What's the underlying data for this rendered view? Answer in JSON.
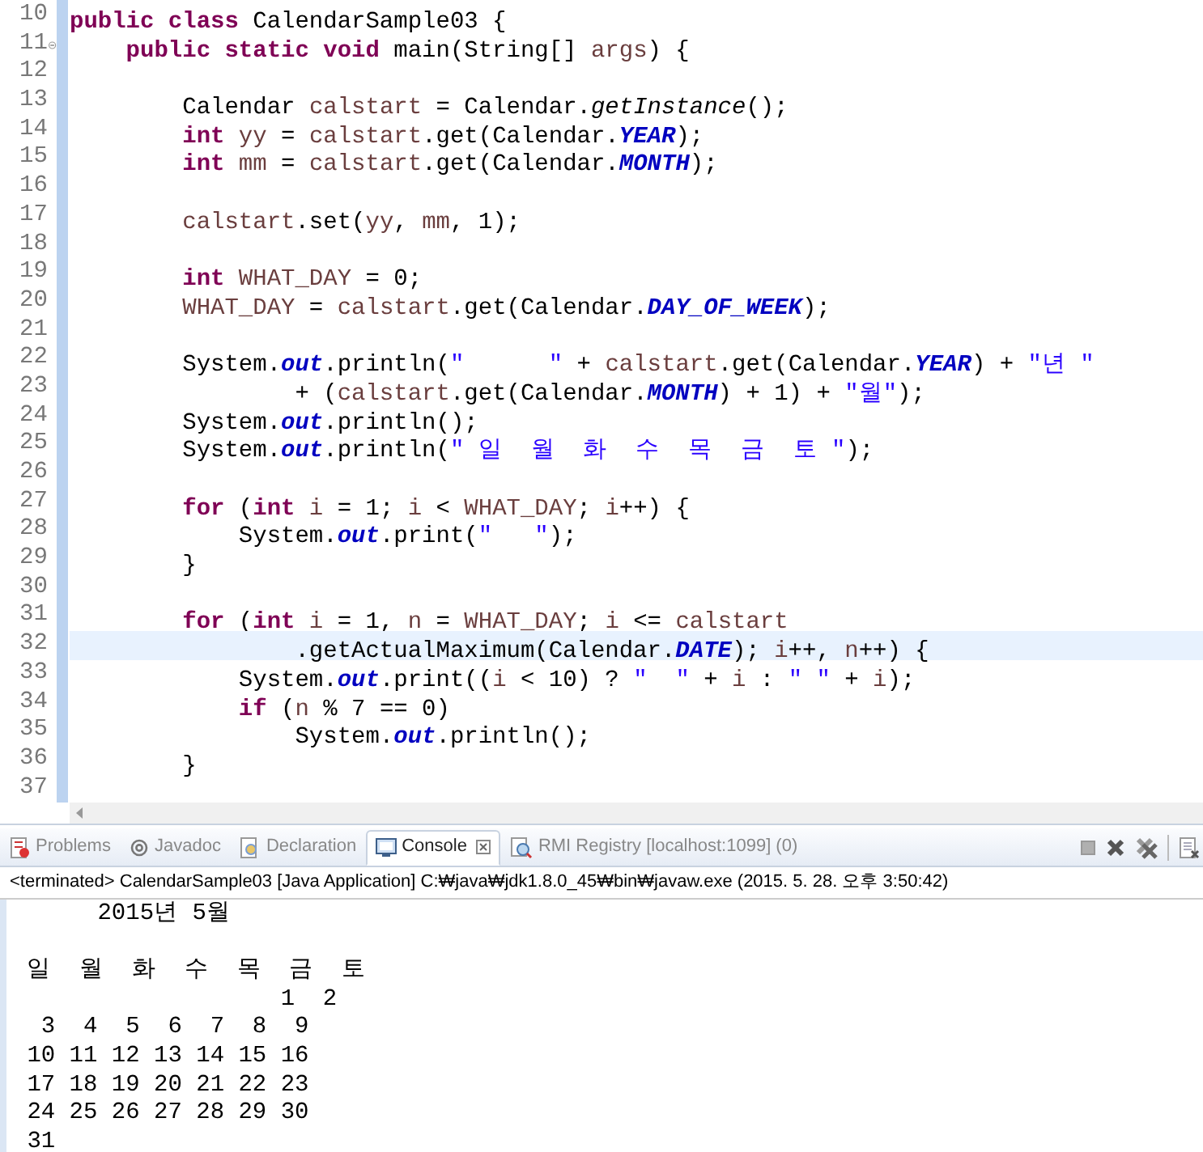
{
  "editor": {
    "lines": [
      {
        "number": "10",
        "foldable": false,
        "current": false,
        "tokens": [
          {
            "kind": "kw",
            "text": "public class"
          },
          {
            "kind": "p",
            "text": " CalendarSample03 {"
          }
        ]
      },
      {
        "number": "11",
        "foldable": true,
        "current": false,
        "tokens": [
          {
            "kind": "kw",
            "text": "    public static void"
          },
          {
            "kind": "p",
            "text": " main(String[] "
          },
          {
            "kind": "var",
            "text": "args"
          },
          {
            "kind": "p",
            "text": ") {"
          }
        ]
      },
      {
        "number": "12",
        "foldable": false,
        "current": false
      },
      {
        "number": "13",
        "foldable": false,
        "current": false,
        "tokens": [
          {
            "kind": "p",
            "text": "        Calendar "
          },
          {
            "kind": "var",
            "text": "calstart"
          },
          {
            "kind": "p",
            "text": " = Calendar."
          },
          {
            "kind": "m",
            "text": "getInstance"
          },
          {
            "kind": "p",
            "text": "();"
          }
        ]
      },
      {
        "number": "14",
        "foldable": false,
        "current": false,
        "tokens": [
          {
            "kind": "kw",
            "text": "        int"
          },
          {
            "kind": "var",
            "text": " yy"
          },
          {
            "kind": "p",
            "text": " = "
          },
          {
            "kind": "var",
            "text": "calstart"
          },
          {
            "kind": "p",
            "text": ".get(Calendar."
          },
          {
            "kind": "c",
            "text": "YEAR"
          },
          {
            "kind": "p",
            "text": ");"
          }
        ]
      },
      {
        "number": "15",
        "foldable": false,
        "current": false,
        "tokens": [
          {
            "kind": "kw",
            "text": "        int"
          },
          {
            "kind": "var",
            "text": " mm"
          },
          {
            "kind": "p",
            "text": " = "
          },
          {
            "kind": "var",
            "text": "calstart"
          },
          {
            "kind": "p",
            "text": ".get(Calendar."
          },
          {
            "kind": "c",
            "text": "MONTH"
          },
          {
            "kind": "p",
            "text": ");"
          }
        ]
      },
      {
        "number": "16",
        "foldable": false,
        "current": false
      },
      {
        "number": "17",
        "foldable": false,
        "current": false,
        "tokens": [
          {
            "kind": "var",
            "text": "        calstart"
          },
          {
            "kind": "p",
            "text": ".set("
          },
          {
            "kind": "var",
            "text": "yy"
          },
          {
            "kind": "p",
            "text": ", "
          },
          {
            "kind": "var",
            "text": "mm"
          },
          {
            "kind": "p",
            "text": ", 1);"
          }
        ]
      },
      {
        "number": "18",
        "foldable": false,
        "current": false
      },
      {
        "number": "19",
        "foldable": false,
        "current": false,
        "tokens": [
          {
            "kind": "kw",
            "text": "        int"
          },
          {
            "kind": "var",
            "text": " WHAT_DAY"
          },
          {
            "kind": "p",
            "text": " = 0;"
          }
        ]
      },
      {
        "number": "20",
        "foldable": false,
        "current": false,
        "tokens": [
          {
            "kind": "var",
            "text": "        WHAT_DAY"
          },
          {
            "kind": "p",
            "text": " = "
          },
          {
            "kind": "var",
            "text": "calstart"
          },
          {
            "kind": "p",
            "text": ".get(Calendar."
          },
          {
            "kind": "c",
            "text": "DAY_OF_WEEK"
          },
          {
            "kind": "p",
            "text": ");"
          }
        ]
      },
      {
        "number": "21",
        "foldable": false,
        "current": false
      },
      {
        "number": "22",
        "foldable": false,
        "current": false,
        "tokens": [
          {
            "kind": "p",
            "text": "        System."
          },
          {
            "kind": "c",
            "text": "out"
          },
          {
            "kind": "p",
            "text": ".println("
          },
          {
            "kind": "s",
            "text": "\"      \""
          },
          {
            "kind": "p",
            "text": " + "
          },
          {
            "kind": "var",
            "text": "calstart"
          },
          {
            "kind": "p",
            "text": ".get(Calendar."
          },
          {
            "kind": "c",
            "text": "YEAR"
          },
          {
            "kind": "p",
            "text": ") + "
          },
          {
            "kind": "s",
            "text": "\"년 \""
          }
        ]
      },
      {
        "number": "23",
        "foldable": false,
        "current": false,
        "tokens": [
          {
            "kind": "p",
            "text": "                + ("
          },
          {
            "kind": "var",
            "text": "calstart"
          },
          {
            "kind": "p",
            "text": ".get(Calendar."
          },
          {
            "kind": "c",
            "text": "MONTH"
          },
          {
            "kind": "p",
            "text": ") + 1) + "
          },
          {
            "kind": "s",
            "text": "\"월\""
          },
          {
            "kind": "p",
            "text": ");"
          }
        ]
      },
      {
        "number": "24",
        "foldable": false,
        "current": false,
        "tokens": [
          {
            "kind": "p",
            "text": "        System."
          },
          {
            "kind": "c",
            "text": "out"
          },
          {
            "kind": "p",
            "text": ".println();"
          }
        ]
      },
      {
        "number": "25",
        "foldable": false,
        "current": false,
        "tokens": [
          {
            "kind": "p",
            "text": "        System."
          },
          {
            "kind": "c",
            "text": "out"
          },
          {
            "kind": "p",
            "text": ".println("
          },
          {
            "kind": "s",
            "text": "\" 일  월  화  수  목  금  토 \""
          },
          {
            "kind": "p",
            "text": ");"
          }
        ]
      },
      {
        "number": "26",
        "foldable": false,
        "current": false
      },
      {
        "number": "27",
        "foldable": false,
        "current": false,
        "tokens": [
          {
            "kind": "kw",
            "text": "        for"
          },
          {
            "kind": "p",
            "text": " ("
          },
          {
            "kind": "kw",
            "text": "int"
          },
          {
            "kind": "var",
            "text": " i"
          },
          {
            "kind": "p",
            "text": " = 1; "
          },
          {
            "kind": "var",
            "text": "i"
          },
          {
            "kind": "p",
            "text": " < "
          },
          {
            "kind": "var",
            "text": "WHAT_DAY"
          },
          {
            "kind": "p",
            "text": "; "
          },
          {
            "kind": "var",
            "text": "i"
          },
          {
            "kind": "p",
            "text": "++) {"
          }
        ]
      },
      {
        "number": "28",
        "foldable": false,
        "current": false,
        "tokens": [
          {
            "kind": "p",
            "text": "            System."
          },
          {
            "kind": "c",
            "text": "out"
          },
          {
            "kind": "p",
            "text": ".print("
          },
          {
            "kind": "s",
            "text": "\"   \""
          },
          {
            "kind": "p",
            "text": ");"
          }
        ]
      },
      {
        "number": "29",
        "foldable": false,
        "current": false,
        "tokens": [
          {
            "kind": "p",
            "text": "        }"
          }
        ]
      },
      {
        "number": "30",
        "foldable": false,
        "current": false
      },
      {
        "number": "31",
        "foldable": false,
        "current": false,
        "tokens": [
          {
            "kind": "kw",
            "text": "        for"
          },
          {
            "kind": "p",
            "text": " ("
          },
          {
            "kind": "kw",
            "text": "int"
          },
          {
            "kind": "var",
            "text": " i"
          },
          {
            "kind": "p",
            "text": " = 1, "
          },
          {
            "kind": "var",
            "text": "n"
          },
          {
            "kind": "p",
            "text": " = "
          },
          {
            "kind": "var",
            "text": "WHAT_DAY"
          },
          {
            "kind": "p",
            "text": "; "
          },
          {
            "kind": "var",
            "text": "i"
          },
          {
            "kind": "p",
            "text": " <= "
          },
          {
            "kind": "var",
            "text": "calstart"
          }
        ]
      },
      {
        "number": "32",
        "foldable": false,
        "current": true,
        "tokens": [
          {
            "kind": "p",
            "text": "                .getActualMaximum(Calendar."
          },
          {
            "kind": "c",
            "text": "DATE"
          },
          {
            "kind": "p",
            "text": "); "
          },
          {
            "kind": "var",
            "text": "i"
          },
          {
            "kind": "p",
            "text": "++, "
          },
          {
            "kind": "var",
            "text": "n"
          },
          {
            "kind": "p",
            "text": "++) {"
          }
        ]
      },
      {
        "number": "33",
        "foldable": false,
        "current": false,
        "tokens": [
          {
            "kind": "p",
            "text": "            System."
          },
          {
            "kind": "c",
            "text": "out"
          },
          {
            "kind": "p",
            "text": ".print(("
          },
          {
            "kind": "var",
            "text": "i"
          },
          {
            "kind": "p",
            "text": " < 10) ? "
          },
          {
            "kind": "s",
            "text": "\"  \""
          },
          {
            "kind": "p",
            "text": " + "
          },
          {
            "kind": "var",
            "text": "i"
          },
          {
            "kind": "p",
            "text": " : "
          },
          {
            "kind": "s",
            "text": "\" \""
          },
          {
            "kind": "p",
            "text": " + "
          },
          {
            "kind": "var",
            "text": "i"
          },
          {
            "kind": "p",
            "text": ");"
          }
        ]
      },
      {
        "number": "34",
        "foldable": false,
        "current": false,
        "tokens": [
          {
            "kind": "kw",
            "text": "            if"
          },
          {
            "kind": "p",
            "text": " ("
          },
          {
            "kind": "var",
            "text": "n"
          },
          {
            "kind": "p",
            "text": " % 7 == 0)"
          }
        ]
      },
      {
        "number": "35",
        "foldable": false,
        "current": false,
        "tokens": [
          {
            "kind": "p",
            "text": "                System."
          },
          {
            "kind": "c",
            "text": "out"
          },
          {
            "kind": "p",
            "text": ".println();"
          }
        ]
      },
      {
        "number": "36",
        "foldable": false,
        "current": false,
        "tokens": [
          {
            "kind": "p",
            "text": "        }"
          }
        ]
      },
      {
        "number": "37",
        "foldable": false,
        "current": false
      }
    ]
  },
  "panel": {
    "tabs": [
      {
        "label": "Problems",
        "selected": false,
        "closable": false
      },
      {
        "label": "Javadoc",
        "selected": false,
        "closable": false
      },
      {
        "label": "Declaration",
        "selected": false,
        "closable": false
      },
      {
        "label": "Console",
        "selected": true,
        "closable": true
      },
      {
        "label": "RMI Registry [localhost:1099] (0)",
        "selected": false,
        "closable": false
      }
    ],
    "console_title": "<terminated> CalendarSample03 [Java Application] C:₩java₩jdk1.8.0_45₩bin₩javaw.exe (2015. 5. 28. 오후 3:50:42)",
    "output": [
      {
        "text": "      2015년 5월",
        "blank_before": false
      },
      {
        "text": " 일  월  화  수  목  금  토 ",
        "blank_before": true
      },
      {
        "text": "                   1  2",
        "blank_before": false
      },
      {
        "text": "  3  4  5  6  7  8  9",
        "blank_before": false
      },
      {
        "text": " 10 11 12 13 14 15 16",
        "blank_before": false
      },
      {
        "text": " 17 18 19 20 21 22 23",
        "blank_before": false
      },
      {
        "text": " 24 25 26 27 28 29 30",
        "blank_before": false
      },
      {
        "text": " 31",
        "blank_before": false
      }
    ]
  }
}
